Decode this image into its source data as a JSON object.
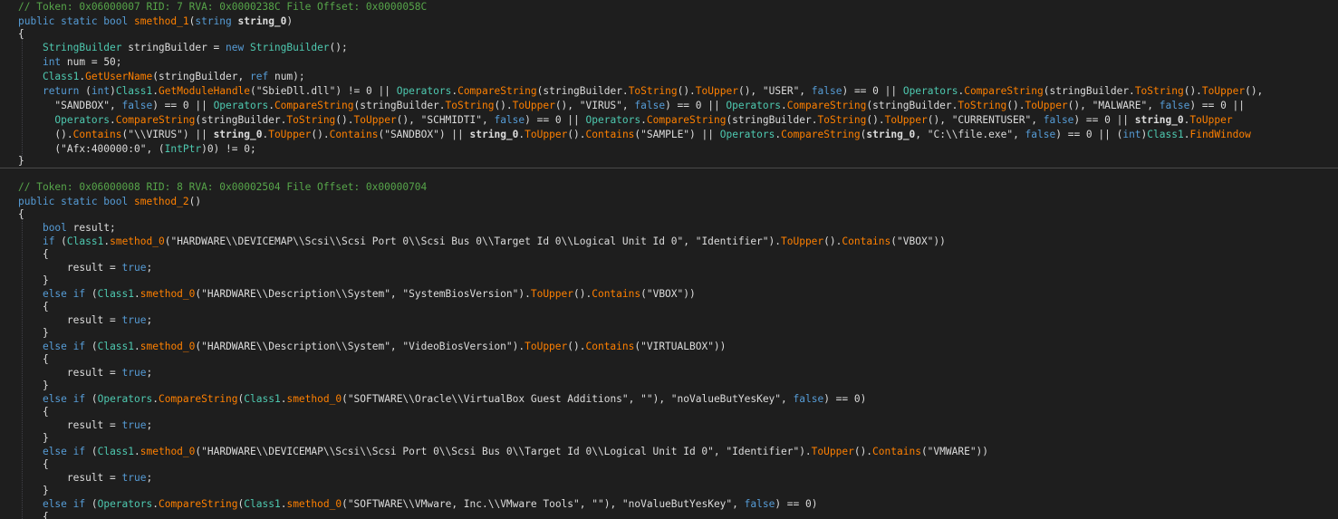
{
  "colors": {
    "background": "#1e1e1e",
    "comment": "#57a64a",
    "keyword": "#569cd6",
    "type": "#4ec9b0",
    "method": "#ff8000",
    "string": "#d69d85",
    "text": "#dcdcdc"
  },
  "method1": {
    "header_comment": "// Token: 0x06000007 RID: 7 RVA: 0x0000238C File Offset: 0x0000058C",
    "lines": [
      [
        [
          "kw",
          "public static bool "
        ],
        [
          "meth",
          "smethod_1"
        ],
        [
          "plain",
          "("
        ],
        [
          "kw",
          "string "
        ],
        [
          "bold",
          "string_0"
        ],
        [
          "plain",
          ")"
        ]
      ],
      [
        [
          "plain",
          "{"
        ]
      ],
      [
        [
          "plain",
          "    "
        ],
        [
          "type",
          "StringBuilder"
        ],
        [
          "plain",
          " stringBuilder = "
        ],
        [
          "kw",
          "new "
        ],
        [
          "type",
          "StringBuilder"
        ],
        [
          "plain",
          "();"
        ]
      ],
      [
        [
          "plain",
          "    "
        ],
        [
          "kw",
          "int"
        ],
        [
          "plain",
          " num = 50;"
        ]
      ],
      [
        [
          "plain",
          "    "
        ],
        [
          "cls",
          "Class1"
        ],
        [
          "plain",
          "."
        ],
        [
          "meth",
          "GetUserName"
        ],
        [
          "plain",
          "(stringBuilder, "
        ],
        [
          "kw",
          "ref"
        ],
        [
          "plain",
          " num);"
        ]
      ],
      [
        [
          "plain",
          "    "
        ],
        [
          "kw",
          "return"
        ],
        [
          "plain",
          " ("
        ],
        [
          "kw",
          "int"
        ],
        [
          "plain",
          ")"
        ],
        [
          "cls",
          "Class1"
        ],
        [
          "plain",
          "."
        ],
        [
          "meth",
          "GetModuleHandle"
        ],
        [
          "plain",
          "(\"SbieDll.dll\") != 0 || "
        ],
        [
          "cls",
          "Operators"
        ],
        [
          "plain",
          "."
        ],
        [
          "meth",
          "CompareString"
        ],
        [
          "plain",
          "(stringBuilder."
        ],
        [
          "meth",
          "ToString"
        ],
        [
          "plain",
          "()."
        ],
        [
          "meth",
          "ToUpper"
        ],
        [
          "plain",
          "(), \"USER\", "
        ],
        [
          "kw",
          "false"
        ],
        [
          "plain",
          ") == 0 || "
        ],
        [
          "cls",
          "Operators"
        ],
        [
          "plain",
          "."
        ],
        [
          "meth",
          "CompareString"
        ],
        [
          "plain",
          "(stringBuilder."
        ],
        [
          "meth",
          "ToString"
        ],
        [
          "plain",
          "()."
        ],
        [
          "meth",
          "ToUpper"
        ],
        [
          "plain",
          "(),"
        ]
      ],
      [
        [
          "plain",
          "      \"SANDBOX\", "
        ],
        [
          "kw",
          "false"
        ],
        [
          "plain",
          ") == 0 || "
        ],
        [
          "cls",
          "Operators"
        ],
        [
          "plain",
          "."
        ],
        [
          "meth",
          "CompareString"
        ],
        [
          "plain",
          "(stringBuilder."
        ],
        [
          "meth",
          "ToString"
        ],
        [
          "plain",
          "()."
        ],
        [
          "meth",
          "ToUpper"
        ],
        [
          "plain",
          "(), \"VIRUS\", "
        ],
        [
          "kw",
          "false"
        ],
        [
          "plain",
          ") == 0 || "
        ],
        [
          "cls",
          "Operators"
        ],
        [
          "plain",
          "."
        ],
        [
          "meth",
          "CompareString"
        ],
        [
          "plain",
          "(stringBuilder."
        ],
        [
          "meth",
          "ToString"
        ],
        [
          "plain",
          "()."
        ],
        [
          "meth",
          "ToUpper"
        ],
        [
          "plain",
          "(), \"MALWARE\", "
        ],
        [
          "kw",
          "false"
        ],
        [
          "plain",
          ") == 0 ||"
        ]
      ],
      [
        [
          "plain",
          "      "
        ],
        [
          "cls",
          "Operators"
        ],
        [
          "plain",
          "."
        ],
        [
          "meth",
          "CompareString"
        ],
        [
          "plain",
          "(stringBuilder."
        ],
        [
          "meth",
          "ToString"
        ],
        [
          "plain",
          "()."
        ],
        [
          "meth",
          "ToUpper"
        ],
        [
          "plain",
          "(), \"SCHMIDTI\", "
        ],
        [
          "kw",
          "false"
        ],
        [
          "plain",
          ") == 0 || "
        ],
        [
          "cls",
          "Operators"
        ],
        [
          "plain",
          "."
        ],
        [
          "meth",
          "CompareString"
        ],
        [
          "plain",
          "(stringBuilder."
        ],
        [
          "meth",
          "ToString"
        ],
        [
          "plain",
          "()."
        ],
        [
          "meth",
          "ToUpper"
        ],
        [
          "plain",
          "(), \"CURRENTUSER\", "
        ],
        [
          "kw",
          "false"
        ],
        [
          "plain",
          ") == 0 || "
        ],
        [
          "bold",
          "string_0"
        ],
        [
          "plain",
          "."
        ],
        [
          "meth",
          "ToUpper"
        ]
      ],
      [
        [
          "plain",
          "      ()."
        ],
        [
          "meth",
          "Contains"
        ],
        [
          "plain",
          "(\"\\\\VIRUS\") || "
        ],
        [
          "bold",
          "string_0"
        ],
        [
          "plain",
          "."
        ],
        [
          "meth",
          "ToUpper"
        ],
        [
          "plain",
          "()."
        ],
        [
          "meth",
          "Contains"
        ],
        [
          "plain",
          "(\"SANDBOX\") || "
        ],
        [
          "bold",
          "string_0"
        ],
        [
          "plain",
          "."
        ],
        [
          "meth",
          "ToUpper"
        ],
        [
          "plain",
          "()."
        ],
        [
          "meth",
          "Contains"
        ],
        [
          "plain",
          "(\"SAMPLE\") || "
        ],
        [
          "cls",
          "Operators"
        ],
        [
          "plain",
          "."
        ],
        [
          "meth",
          "CompareString"
        ],
        [
          "plain",
          "("
        ],
        [
          "bold",
          "string_0"
        ],
        [
          "plain",
          ", \"C:\\\\file.exe\", "
        ],
        [
          "kw",
          "false"
        ],
        [
          "plain",
          ") == 0 || ("
        ],
        [
          "kw",
          "int"
        ],
        [
          "plain",
          ")"
        ],
        [
          "cls",
          "Class1"
        ],
        [
          "plain",
          "."
        ],
        [
          "meth",
          "FindWindow"
        ]
      ],
      [
        [
          "plain",
          "      (\"Afx:400000:0\", ("
        ],
        [
          "type",
          "IntPtr"
        ],
        [
          "plain",
          ")0) != 0;"
        ]
      ],
      [
        [
          "plain",
          "}"
        ]
      ]
    ]
  },
  "method2": {
    "header_comment": "// Token: 0x06000008 RID: 8 RVA: 0x00002504 File Offset: 0x00000704",
    "lines": [
      [
        [
          "kw",
          "public static bool "
        ],
        [
          "meth",
          "smethod_2"
        ],
        [
          "plain",
          "()"
        ]
      ],
      [
        [
          "plain",
          "{"
        ]
      ],
      [
        [
          "plain",
          "    "
        ],
        [
          "kw",
          "bool"
        ],
        [
          "plain",
          " result;"
        ]
      ],
      [
        [
          "plain",
          "    "
        ],
        [
          "kw",
          "if"
        ],
        [
          "plain",
          " ("
        ],
        [
          "cls",
          "Class1"
        ],
        [
          "plain",
          "."
        ],
        [
          "meth",
          "smethod_0"
        ],
        [
          "plain",
          "(\"HARDWARE\\\\DEVICEMAP\\\\Scsi\\\\Scsi Port 0\\\\Scsi Bus 0\\\\Target Id 0\\\\Logical Unit Id 0\", \"Identifier\")."
        ],
        [
          "meth",
          "ToUpper"
        ],
        [
          "plain",
          "()."
        ],
        [
          "meth",
          "Contains"
        ],
        [
          "plain",
          "(\"VBOX\"))"
        ]
      ],
      [
        [
          "plain",
          "    {"
        ]
      ],
      [
        [
          "plain",
          "        result = "
        ],
        [
          "kw",
          "true"
        ],
        [
          "plain",
          ";"
        ]
      ],
      [
        [
          "plain",
          "    }"
        ]
      ],
      [
        [
          "plain",
          "    "
        ],
        [
          "kw",
          "else if"
        ],
        [
          "plain",
          " ("
        ],
        [
          "cls",
          "Class1"
        ],
        [
          "plain",
          "."
        ],
        [
          "meth",
          "smethod_0"
        ],
        [
          "plain",
          "(\"HARDWARE\\\\Description\\\\System\", \"SystemBiosVersion\")."
        ],
        [
          "meth",
          "ToUpper"
        ],
        [
          "plain",
          "()."
        ],
        [
          "meth",
          "Contains"
        ],
        [
          "plain",
          "(\"VBOX\"))"
        ]
      ],
      [
        [
          "plain",
          "    {"
        ]
      ],
      [
        [
          "plain",
          "        result = "
        ],
        [
          "kw",
          "true"
        ],
        [
          "plain",
          ";"
        ]
      ],
      [
        [
          "plain",
          "    }"
        ]
      ],
      [
        [
          "plain",
          "    "
        ],
        [
          "kw",
          "else if"
        ],
        [
          "plain",
          " ("
        ],
        [
          "cls",
          "Class1"
        ],
        [
          "plain",
          "."
        ],
        [
          "meth",
          "smethod_0"
        ],
        [
          "plain",
          "(\"HARDWARE\\\\Description\\\\System\", \"VideoBiosVersion\")."
        ],
        [
          "meth",
          "ToUpper"
        ],
        [
          "plain",
          "()."
        ],
        [
          "meth",
          "Contains"
        ],
        [
          "plain",
          "(\"VIRTUALBOX\"))"
        ]
      ],
      [
        [
          "plain",
          "    {"
        ]
      ],
      [
        [
          "plain",
          "        result = "
        ],
        [
          "kw",
          "true"
        ],
        [
          "plain",
          ";"
        ]
      ],
      [
        [
          "plain",
          "    }"
        ]
      ],
      [
        [
          "plain",
          "    "
        ],
        [
          "kw",
          "else if"
        ],
        [
          "plain",
          " ("
        ],
        [
          "cls",
          "Operators"
        ],
        [
          "plain",
          "."
        ],
        [
          "meth",
          "CompareString"
        ],
        [
          "plain",
          "("
        ],
        [
          "cls",
          "Class1"
        ],
        [
          "plain",
          "."
        ],
        [
          "meth",
          "smethod_0"
        ],
        [
          "plain",
          "(\"SOFTWARE\\\\Oracle\\\\VirtualBox Guest Additions\", \"\"), \"noValueButYesKey\", "
        ],
        [
          "kw",
          "false"
        ],
        [
          "plain",
          ") == 0)"
        ]
      ],
      [
        [
          "plain",
          "    {"
        ]
      ],
      [
        [
          "plain",
          "        result = "
        ],
        [
          "kw",
          "true"
        ],
        [
          "plain",
          ";"
        ]
      ],
      [
        [
          "plain",
          "    }"
        ]
      ],
      [
        [
          "plain",
          "    "
        ],
        [
          "kw",
          "else if"
        ],
        [
          "plain",
          " ("
        ],
        [
          "cls",
          "Class1"
        ],
        [
          "plain",
          "."
        ],
        [
          "meth",
          "smethod_0"
        ],
        [
          "plain",
          "(\"HARDWARE\\\\DEVICEMAP\\\\Scsi\\\\Scsi Port 0\\\\Scsi Bus 0\\\\Target Id 0\\\\Logical Unit Id 0\", \"Identifier\")."
        ],
        [
          "meth",
          "ToUpper"
        ],
        [
          "plain",
          "()."
        ],
        [
          "meth",
          "Contains"
        ],
        [
          "plain",
          "(\"VMWARE\"))"
        ]
      ],
      [
        [
          "plain",
          "    {"
        ]
      ],
      [
        [
          "plain",
          "        result = "
        ],
        [
          "kw",
          "true"
        ],
        [
          "plain",
          ";"
        ]
      ],
      [
        [
          "plain",
          "    }"
        ]
      ],
      [
        [
          "plain",
          "    "
        ],
        [
          "kw",
          "else if"
        ],
        [
          "plain",
          " ("
        ],
        [
          "cls",
          "Operators"
        ],
        [
          "plain",
          "."
        ],
        [
          "meth",
          "CompareString"
        ],
        [
          "plain",
          "("
        ],
        [
          "cls",
          "Class1"
        ],
        [
          "plain",
          "."
        ],
        [
          "meth",
          "smethod_0"
        ],
        [
          "plain",
          "(\"SOFTWARE\\\\VMware, Inc.\\\\VMware Tools\", \"\"), \"noValueButYesKey\", "
        ],
        [
          "kw",
          "false"
        ],
        [
          "plain",
          ") == 0)"
        ]
      ],
      [
        [
          "plain",
          "    {"
        ]
      ]
    ]
  }
}
